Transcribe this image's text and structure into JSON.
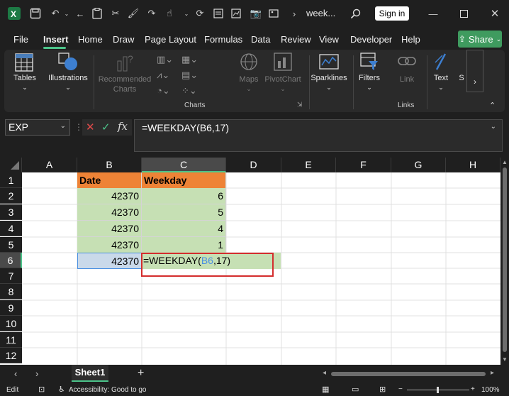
{
  "titlebar": {
    "doc_title": "week...",
    "signin_label": "Sign in"
  },
  "menu": {
    "items": [
      "File",
      "Insert",
      "Home",
      "Draw",
      "Page Layout",
      "Formulas",
      "Data",
      "Review",
      "View",
      "Developer",
      "Help"
    ],
    "share_label": "Share"
  },
  "ribbon": {
    "tables_label": "Tables",
    "illustrations_label": "Illustrations",
    "recommended_charts_label_1": "Recommended",
    "recommended_charts_label_2": "Charts",
    "maps_label": "Maps",
    "pivotchart_label": "PivotChart",
    "sparklines_label": "Sparklines",
    "filters_label": "Filters",
    "link_label": "Link",
    "text_label": "Text",
    "symbols_label": "S",
    "group_charts": "Charts",
    "group_links": "Links"
  },
  "formula_bar": {
    "namebox": "EXP",
    "fx": "fx",
    "formula": "=WEEKDAY(B6,17)"
  },
  "columns": [
    "A",
    "B",
    "C",
    "D",
    "E",
    "F",
    "G",
    "H"
  ],
  "rows": [
    "1",
    "2",
    "3",
    "4",
    "5",
    "6",
    "7",
    "8",
    "9",
    "10",
    "11",
    "12"
  ],
  "table": {
    "header_date": "Date",
    "header_weekday": "Weekday",
    "dates": [
      "42370",
      "42370",
      "42370",
      "42370",
      "42370"
    ],
    "weekdays": [
      "6",
      "5",
      "4",
      "1"
    ],
    "edit_prefix": "=WEEKDAY(",
    "edit_ref": "B6",
    "edit_suffix": ",17)"
  },
  "sheet": {
    "tab": "Sheet1",
    "add": "+"
  },
  "status": {
    "mode": "Edit",
    "accessibility": "Accessibility: Good to go",
    "zoom": "100%"
  },
  "colors": {
    "accent_green": "#3f9b5f",
    "header_orange": "#ee8336",
    "cell_green": "#c6e0b4",
    "highlight_red": "#d42d2d",
    "ref_blue": "#4a90e2"
  }
}
